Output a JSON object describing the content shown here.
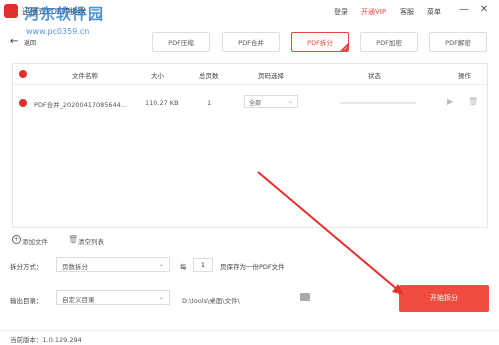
{
  "titlebar": {
    "app_title": "迅捷式PDF转换器",
    "watermark": "河东软件园",
    "watermark_url": "www.pc0359.cn",
    "links": {
      "login": "登录",
      "vip": "开通VIP",
      "service": "客服",
      "menu": "菜单"
    },
    "window_buttons": {
      "minimize": "—",
      "close": "✕"
    }
  },
  "nav": {
    "back_icon": "←",
    "back_label": "返回"
  },
  "tabs": [
    {
      "label": "PDF压缩",
      "active": false
    },
    {
      "label": "PDF合并",
      "active": false
    },
    {
      "label": "PDF拆分",
      "active": true
    },
    {
      "label": "PDF加密",
      "active": false
    },
    {
      "label": "PDF解密",
      "active": false
    }
  ],
  "table": {
    "headers": {
      "name": "文件名称",
      "size": "大小",
      "pages": "总页数",
      "page_select": "页码选择",
      "status": "状态",
      "ops": "操作"
    },
    "rows": [
      {
        "name": "PDF合并_20200417085644...",
        "size": "110.27 KB",
        "pages": "1",
        "page_select": "全部",
        "progress": 0.0
      }
    ]
  },
  "list_actions": {
    "add": "添加文件",
    "clear": "清空列表"
  },
  "options": {
    "split_mode_label": "拆分方式：",
    "split_mode_value": "页数拆分",
    "every_label": "每",
    "every_value": "1",
    "every_suffix": "页保存为一份PDF文件",
    "output_label": "输出目录：",
    "output_value": "自定义目录",
    "output_path": "D:\\tools\\桌面\\文件\\"
  },
  "start_button": "开始拆分",
  "footer": {
    "version": "当前版本：1.0.129.294"
  },
  "colors": {
    "accent": "#ef4c3f",
    "watermark": "#2e7fd1"
  }
}
